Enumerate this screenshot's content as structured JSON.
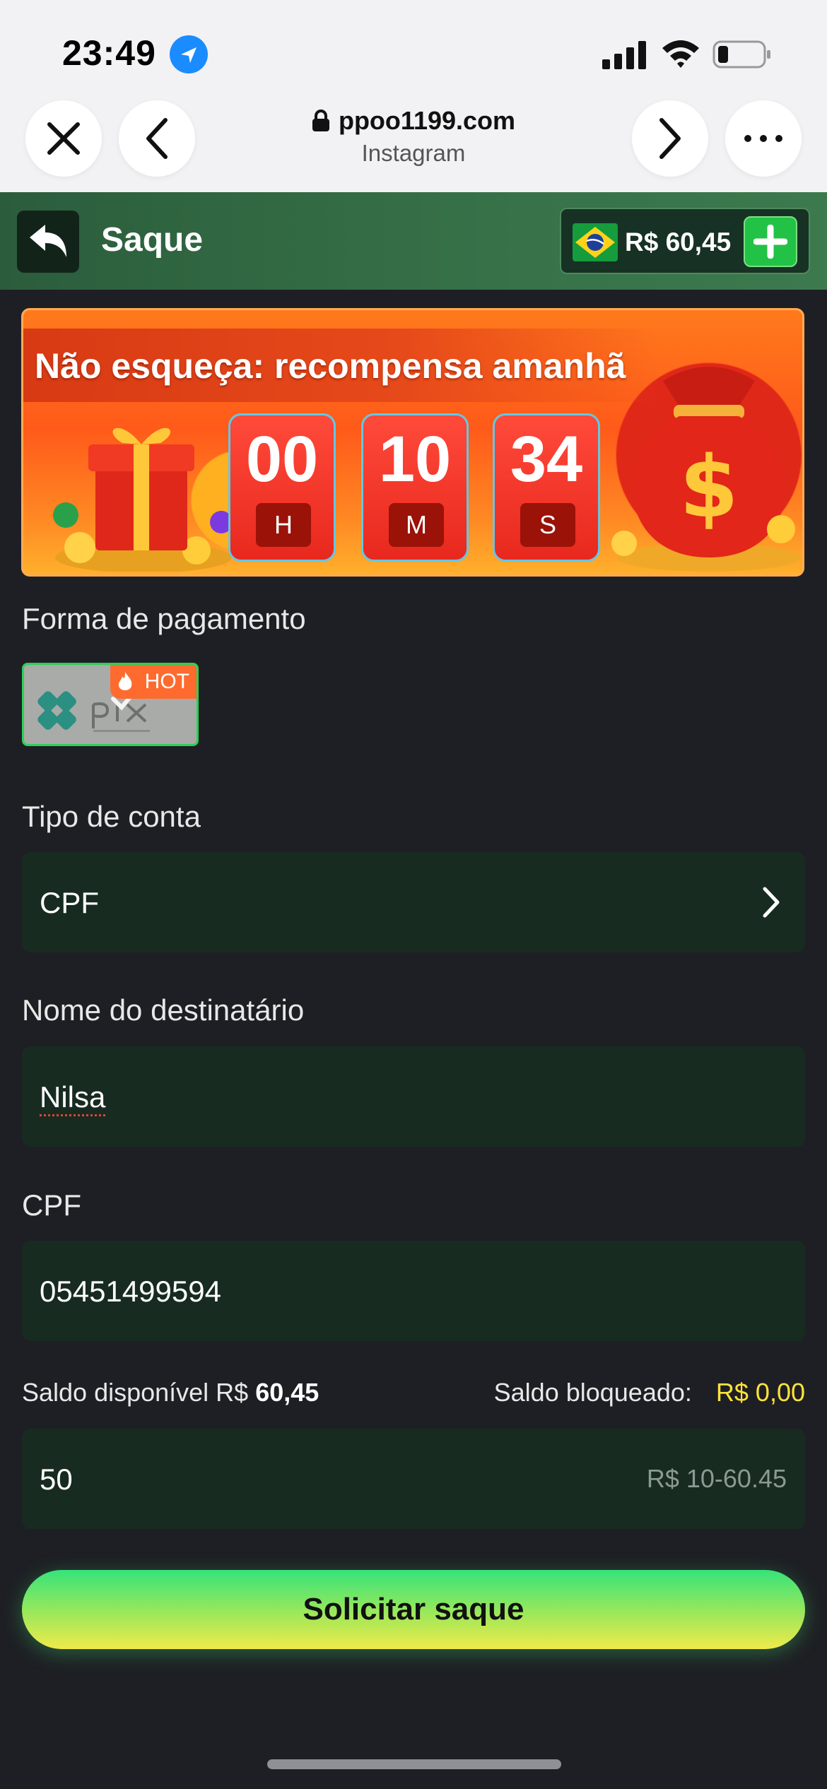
{
  "status_bar": {
    "time": "23:49"
  },
  "browser": {
    "domain": "ppoo1199.com",
    "subtitle": "Instagram"
  },
  "header": {
    "title": "Saque",
    "balance": "R$ 60,45"
  },
  "banner": {
    "text": "Não esqueça: recompensa amanhã",
    "hours": "00",
    "hours_label": "H",
    "minutes": "10",
    "minutes_label": "M",
    "seconds": "34",
    "seconds_label": "S"
  },
  "payment": {
    "label": "Forma de pagamento",
    "method": "pix",
    "badge": "HOT"
  },
  "account_type": {
    "label": "Tipo de conta",
    "value": "CPF"
  },
  "recipient": {
    "label": "Nome do destinatário",
    "value": "Nilsa"
  },
  "cpf": {
    "label": "CPF",
    "value": "05451499594"
  },
  "saldo": {
    "available_label": "Saldo disponível R$",
    "available_value": "60,45",
    "blocked_label": "Saldo bloqueado:",
    "blocked_value": "R$ 0,00"
  },
  "amount": {
    "value": "50",
    "hint": "R$ 10-60.45"
  },
  "submit_label": "Solicitar saque",
  "colors": {
    "accent_green": "#22c247",
    "highlight_yellow": "#ffe23a",
    "field_bg": "#172b20"
  }
}
